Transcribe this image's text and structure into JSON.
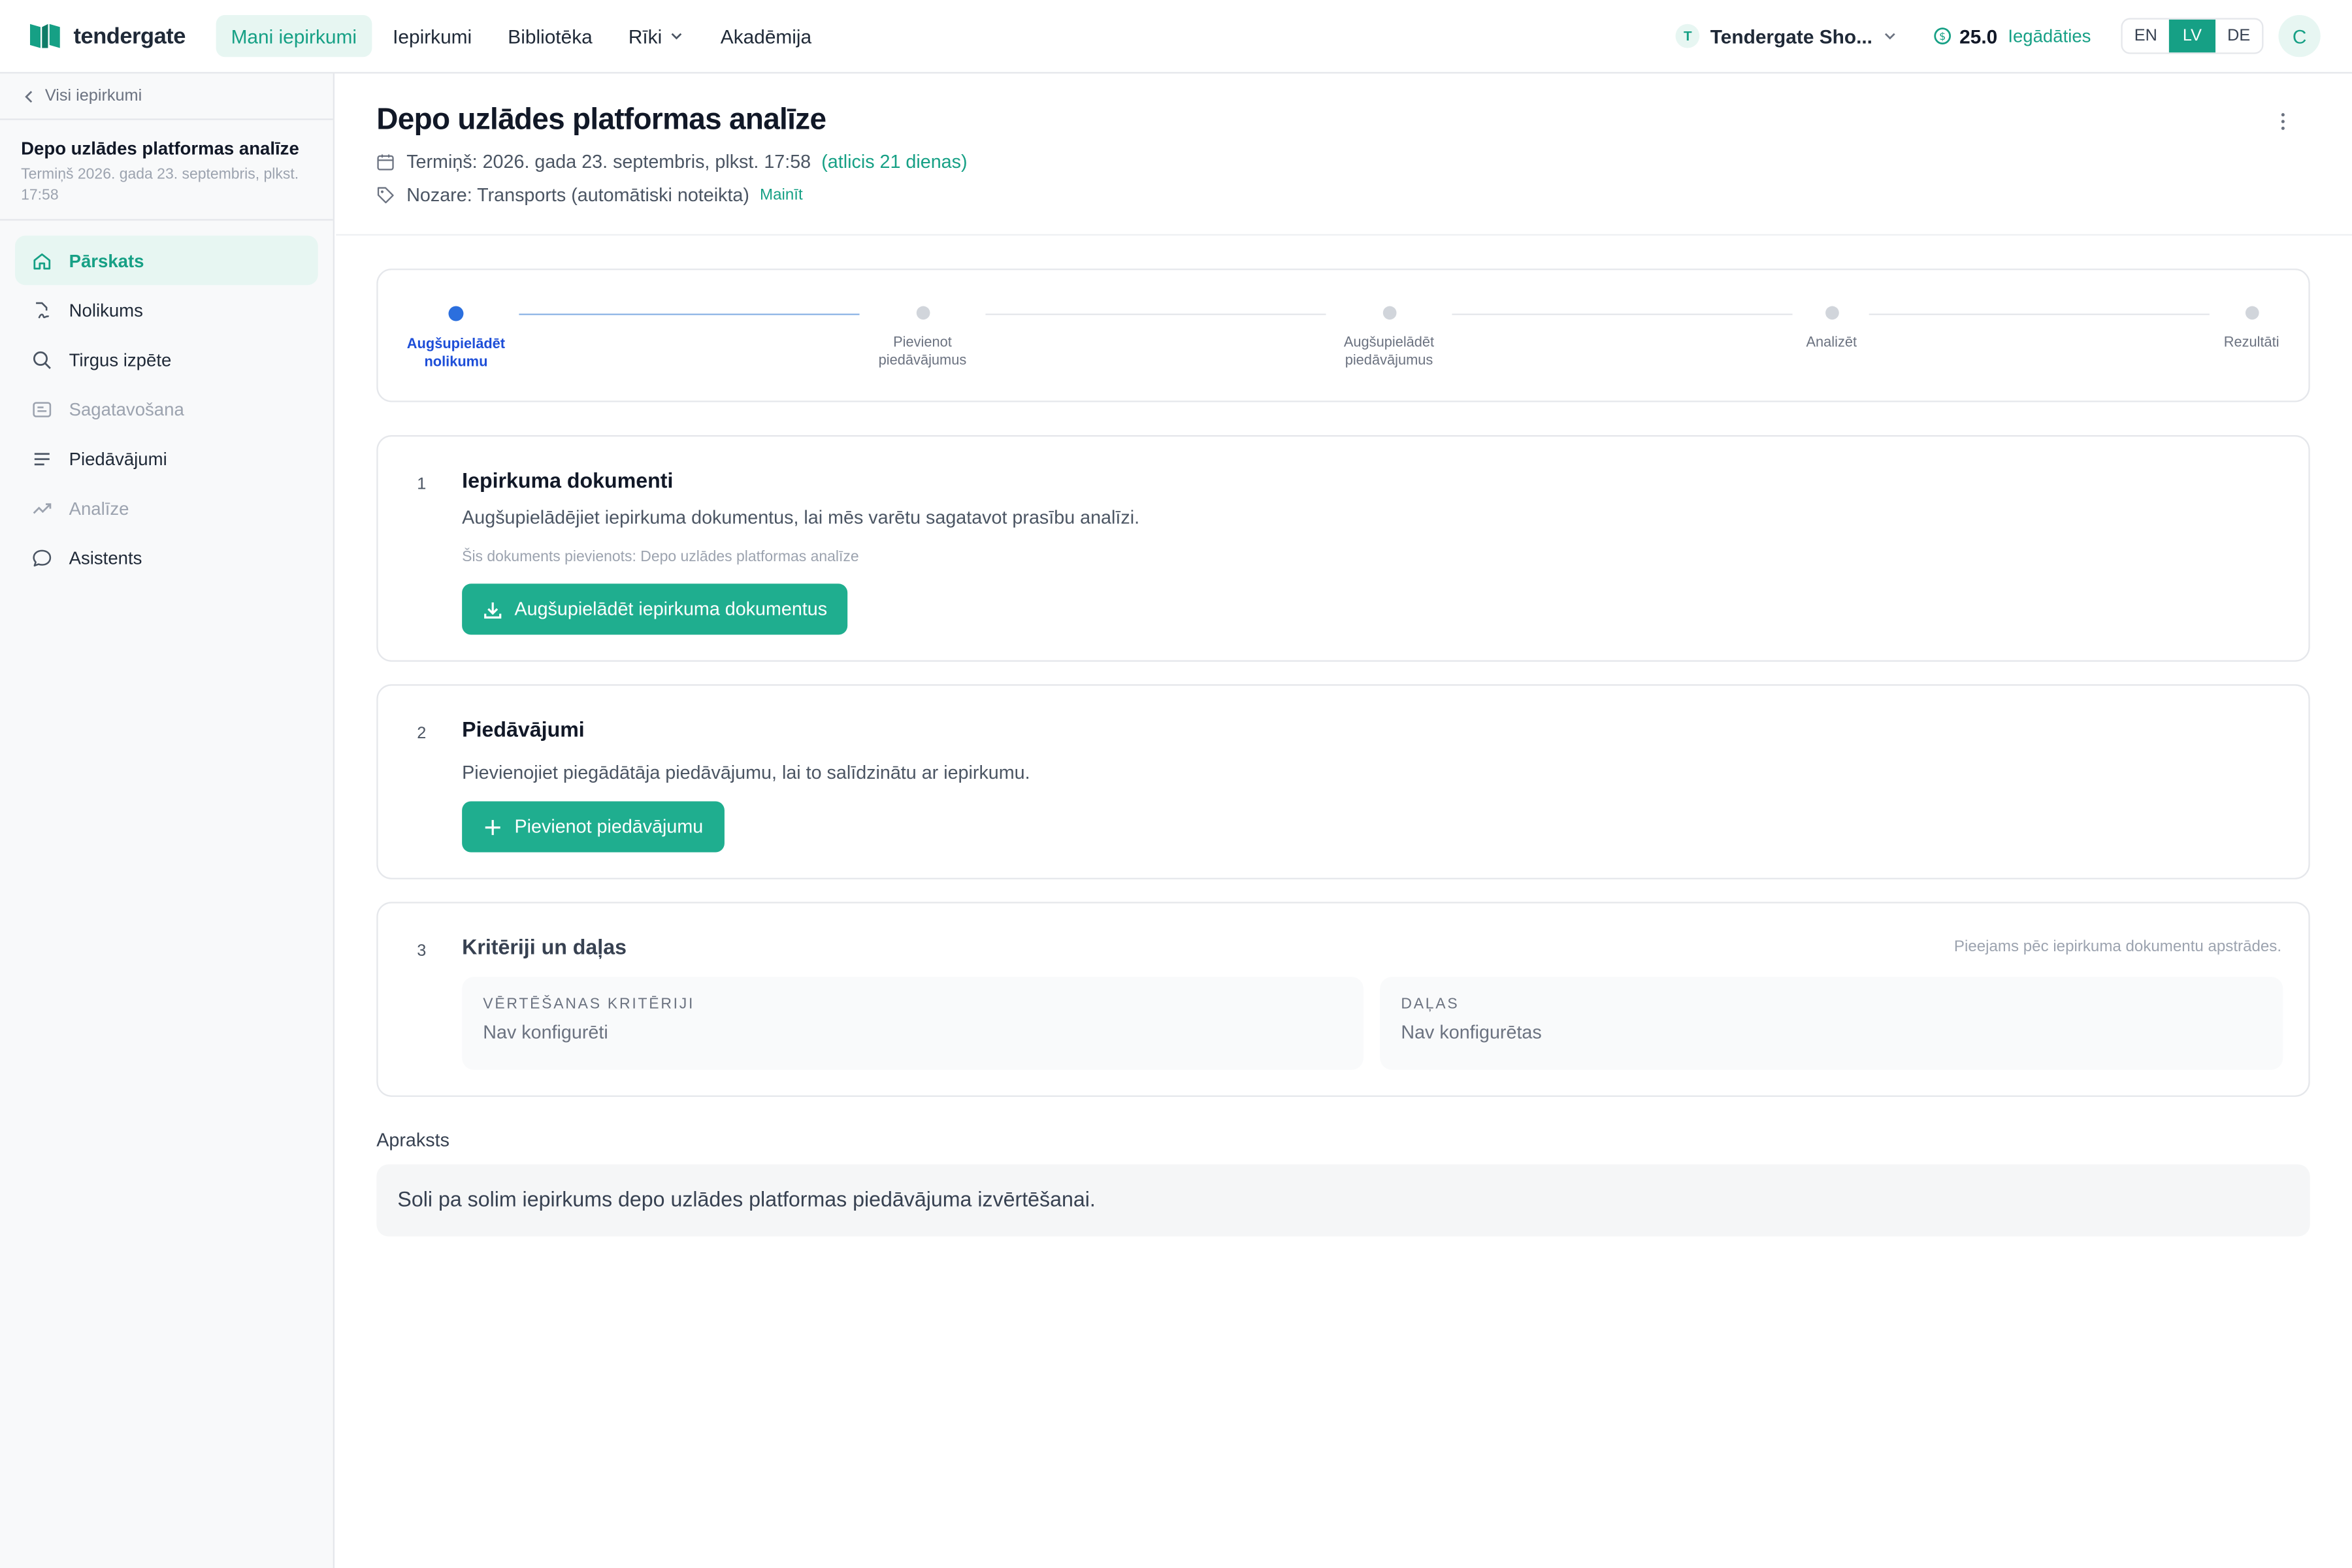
{
  "app": {
    "logo_text": "tendergate",
    "colors": {
      "accent": "#16a085",
      "accent_button": "#1fae8f",
      "accent_soft": "#e7f6f2",
      "step_active": "#2b6fde"
    }
  },
  "topnav": {
    "items": [
      {
        "label": "Mani iepirkumi",
        "active": true
      },
      {
        "label": "Iepirkumi"
      },
      {
        "label": "Bibliotēka"
      },
      {
        "label": "Rīki",
        "has_dropdown": true
      },
      {
        "label": "Akadēmija"
      }
    ],
    "org": {
      "badge": "T",
      "name": "Tendergate Sho..."
    },
    "credits": {
      "value": "25.0",
      "link": "Iegādāties"
    },
    "languages": [
      "EN",
      "LV",
      "DE"
    ],
    "active_language": "LV",
    "avatar": "C"
  },
  "sidebar": {
    "back_label": "Visi iepirkumi",
    "project_title": "Depo uzlādes platformas analīze",
    "project_deadline": "Termiņš 2026. gada 23. septembris, plkst. 17:58",
    "items": [
      {
        "label": "Pārskats",
        "icon": "home-icon",
        "active": true
      },
      {
        "label": "Nolikums",
        "icon": "file-signature-icon"
      },
      {
        "label": "Tirgus izpēte",
        "icon": "search-icon"
      },
      {
        "label": "Sagatavošana",
        "icon": "form-icon",
        "muted": true
      },
      {
        "label": "Piedāvājumi",
        "icon": "list-icon"
      },
      {
        "label": "Analīze",
        "icon": "trend-icon",
        "muted": true
      },
      {
        "label": "Asistents",
        "icon": "chat-icon"
      }
    ]
  },
  "header": {
    "title": "Depo uzlādes platformas analīze",
    "deadline": "Termiņš: 2026. gada 23. septembris, plkst. 17:58",
    "deadline_remaining": "(atlicis 21 dienas)",
    "industry": "Nozare: Transports (automātiski noteikta)",
    "change_link": "Mainīt"
  },
  "stepper": {
    "steps": [
      {
        "label_1": "Augšupielādēt",
        "label_2": "nolikumu",
        "active": true
      },
      {
        "label_1": "Pievienot",
        "label_2": "piedāvājumus"
      },
      {
        "label_1": "Augšupielādēt",
        "label_2": "piedāvājumus"
      },
      {
        "label_1": "Analizēt",
        "label_2": ""
      },
      {
        "label_1": "Rezultāti",
        "label_2": ""
      }
    ]
  },
  "cards": {
    "documents": {
      "number": "1",
      "title": "Iepirkuma dokumenti",
      "description": "Augšupielādējiet iepirkuma dokumentus, lai mēs varētu sagatavot prasību analīzi.",
      "note": "Šis dokuments pievienots: Depo uzlādes platformas analīze",
      "button": "Augšupielādēt iepirkuma dokumentus"
    },
    "offers": {
      "number": "2",
      "title": "Piedāvājumi",
      "description": "Pievienojiet piegādātāja piedāvājumu, lai to salīdzinātu ar iepirkumu.",
      "button": "Pievienot piedāvājumu"
    },
    "criteria": {
      "number": "3",
      "title": "Kritēriji un daļas",
      "availability_note": "Pieejams pēc iepirkuma dokumentu apstrādes.",
      "criteria_label": "Vērtēšanas kritēriji",
      "criteria_value": "Nav konfigurēti",
      "parts_label": "Daļas",
      "parts_value": "Nav konfigurētas"
    }
  },
  "description": {
    "label": "Apraksts",
    "text": "Soli pa solim iepirkums depo uzlādes platformas piedāvājuma izvērtēšanai."
  }
}
